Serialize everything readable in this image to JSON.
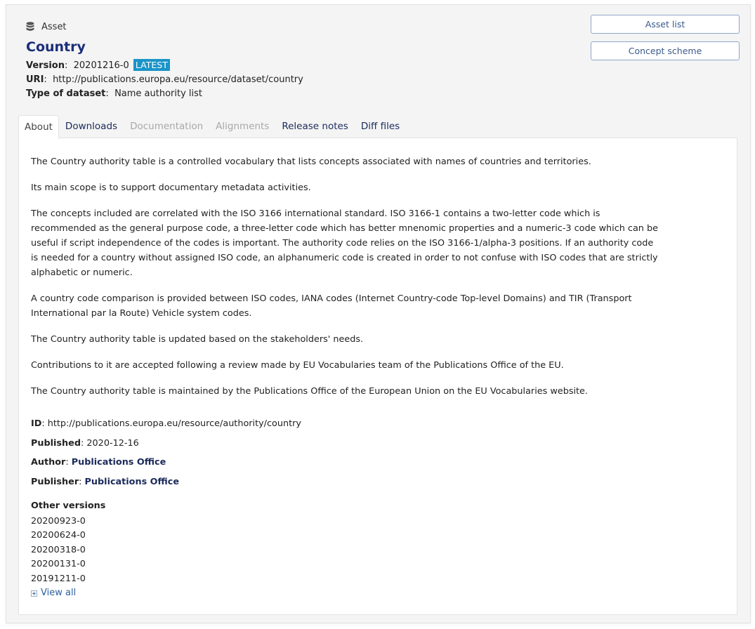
{
  "header": {
    "asset_label": "Asset",
    "asset_icon": "database-icon",
    "title": "Country",
    "version_label": "Version",
    "version_value": "20201216-0",
    "version_badge": "LATEST",
    "uri_label": "URI",
    "uri_value": "http://publications.europa.eu/resource/dataset/country",
    "type_label": "Type of dataset",
    "type_value": "Name authority list"
  },
  "buttons": {
    "asset_list": "Asset list",
    "concept_scheme": "Concept scheme"
  },
  "tabs": [
    {
      "label": "About",
      "state": "active"
    },
    {
      "label": "Downloads",
      "state": "enabled"
    },
    {
      "label": "Documentation",
      "state": "disabled"
    },
    {
      "label": "Alignments",
      "state": "disabled"
    },
    {
      "label": "Release notes",
      "state": "enabled"
    },
    {
      "label": "Diff files",
      "state": "enabled"
    }
  ],
  "about": {
    "paragraphs": [
      "The Country authority table is a controlled vocabulary that lists concepts associated with names of countries and territories.",
      "Its main scope is to support documentary metadata activities.",
      "The concepts included are correlated with the ISO 3166 international standard. ISO 3166-1 contains a two-letter code which is recommended as the general purpose code, a three-letter code which has better mnenomic properties and a numeric-3 code which can be useful if script independence of the codes is important. The authority code relies on the ISO 3166-1/alpha-3 positions. If an authority code is needed for a country without assigned ISO code, an alphanumeric code is created in order to not confuse with ISO codes that are strictly alphabetic or numeric.",
      "A country code comparison is provided between ISO codes, IANA codes (Internet Country-code Top-level Domains) and TIR (Transport International par la Route) Vehicle system codes.",
      "The Country authority table is updated based on the stakeholders' needs.",
      "Contributions to it are accepted following a review made by EU Vocabularies team of the Publications Office of the EU.",
      "The Country authority table is maintained by the Publications Office of the European Union on the EU Vocabularies website."
    ],
    "id_label": "ID",
    "id_value": "http://publications.europa.eu/resource/authority/country",
    "published_label": "Published",
    "published_value": "2020-12-16",
    "author_label": "Author",
    "author_value": "Publications Office",
    "publisher_label": "Publisher",
    "publisher_value": "Publications Office"
  },
  "other_versions": {
    "heading": "Other versions",
    "items": [
      "20200923-0",
      "20200624-0",
      "20200318-0",
      "20200131-0",
      "20191211-0"
    ],
    "view_all": "View all"
  },
  "colors": {
    "title": "#1b2f7a",
    "badge": "#1b94c8",
    "link": "#1b2a5a",
    "disabled_tab": "#a8a8a8"
  }
}
